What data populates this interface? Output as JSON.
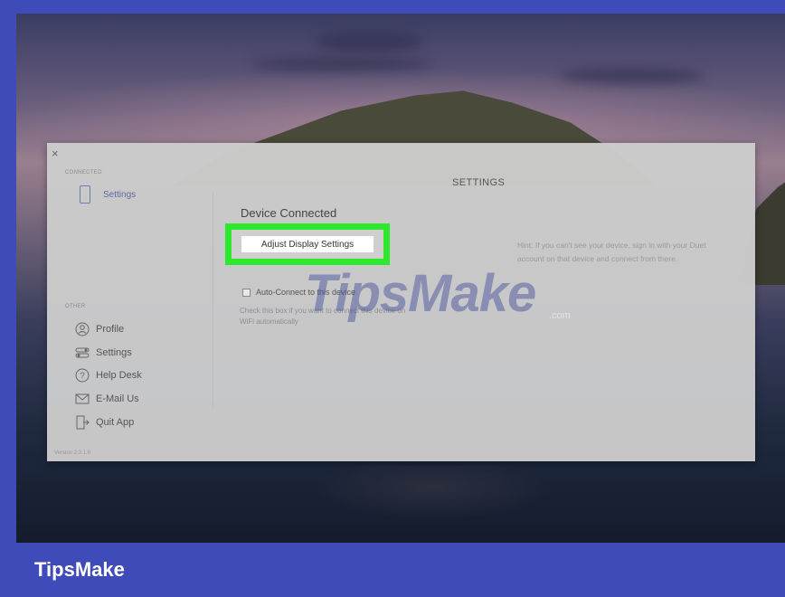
{
  "panel": {
    "close_glyph": "×",
    "connected_label": "CONNECTED",
    "other_label": "OTHER",
    "version": "Version 2.3.1.6",
    "title": "SETTINGS"
  },
  "sidebar": {
    "top_item": {
      "label": "Settings",
      "icon": "device-icon"
    },
    "items": [
      {
        "label": "Profile",
        "icon": "profile-icon"
      },
      {
        "label": "Settings",
        "icon": "settings-toggle-icon"
      },
      {
        "label": "Help Desk",
        "icon": "help-icon"
      },
      {
        "label": "E-Mail Us",
        "icon": "mail-icon"
      },
      {
        "label": "Quit App",
        "icon": "quit-icon"
      }
    ]
  },
  "main": {
    "heading": "Device Connected",
    "adjust_button": "Adjust Display Settings",
    "checkbox_label": "Auto-Connect to this device",
    "checkbox_desc": "Check this box if you want to connect this device on WiFi automatically",
    "hint": "Hint: If you can't see your device, sign in with your Duet account on that device and connect from there.",
    "highlight_color": "#2ee82e"
  },
  "watermark": {
    "text": "TipsMake",
    "suffix": ".com"
  },
  "footer": {
    "brand": "TipsMake",
    "bar_color": "#3f4bb8"
  }
}
